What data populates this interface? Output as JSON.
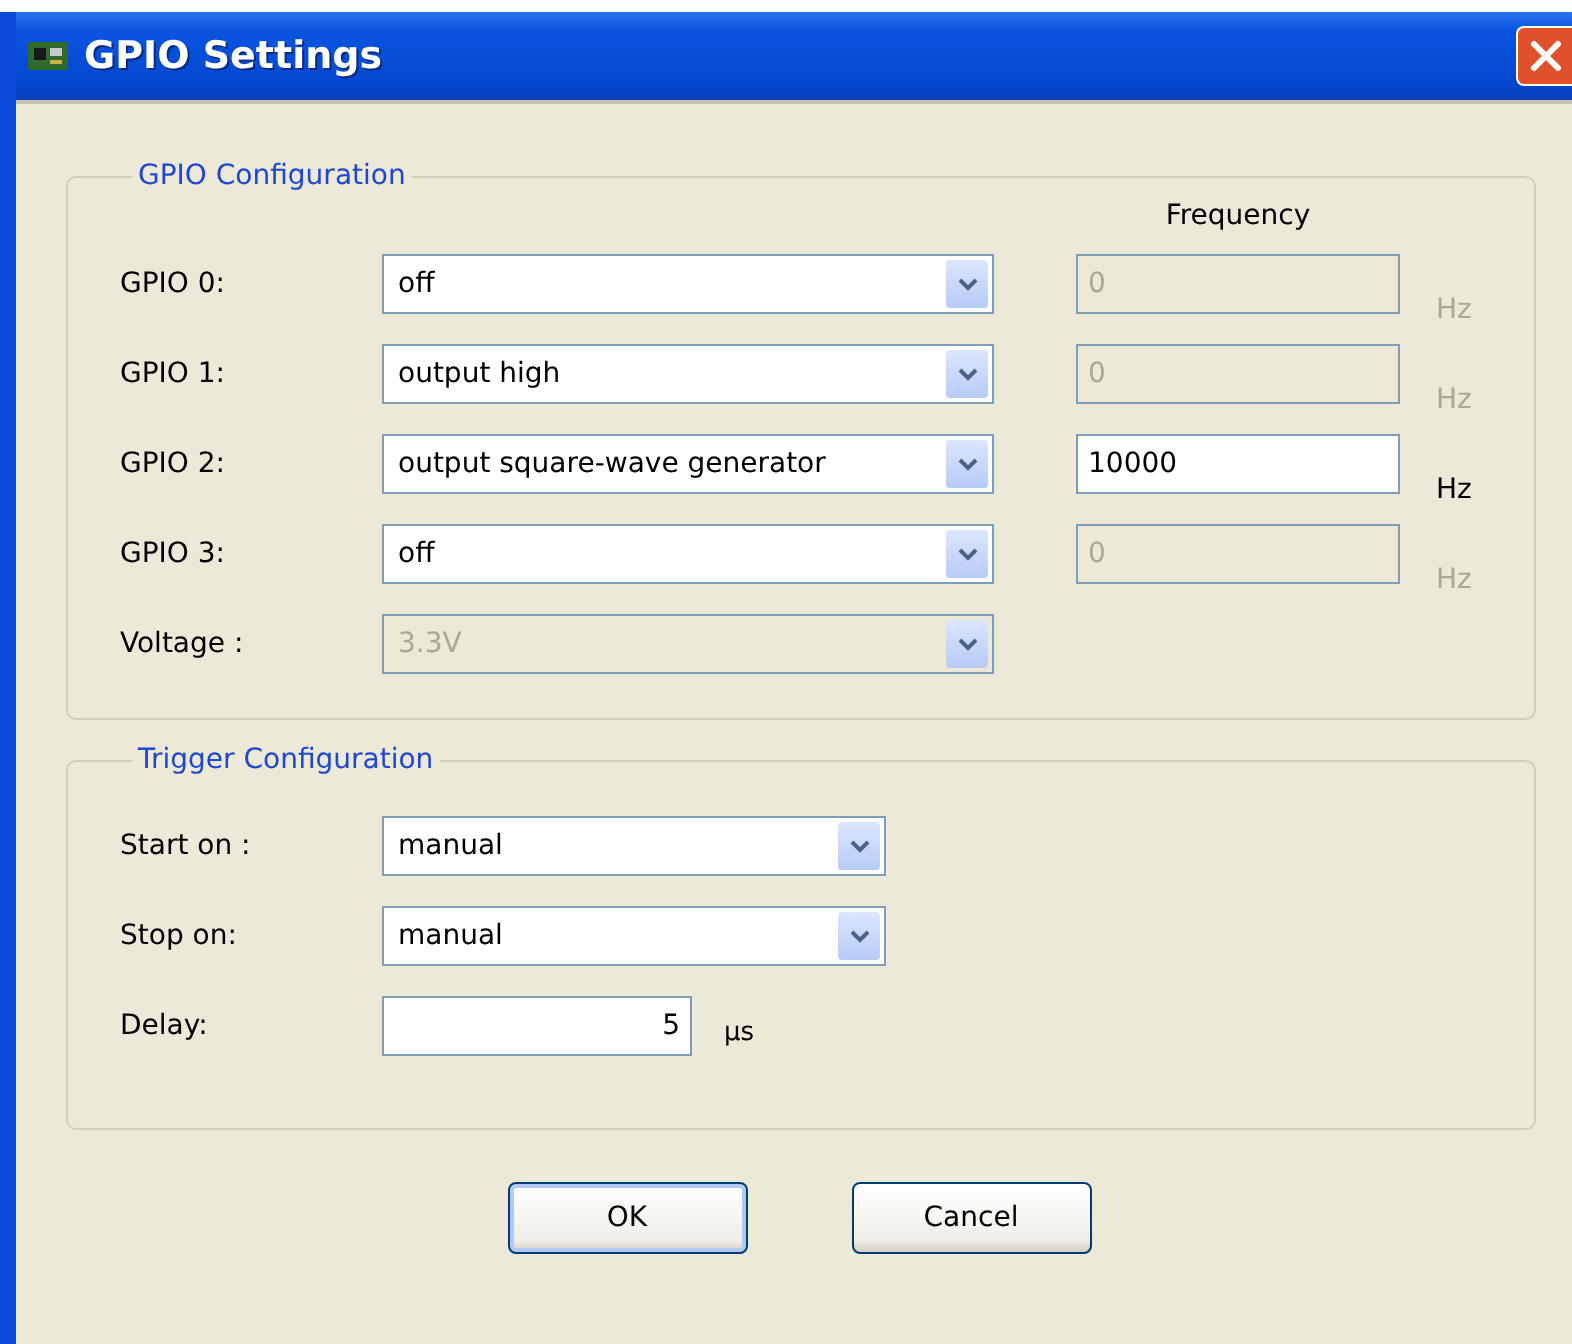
{
  "window": {
    "title": "GPIO Settings"
  },
  "gpio_configuration": {
    "title": "GPIO Configuration",
    "frequency_heading": "Frequency",
    "rows": [
      {
        "label": "GPIO 0:",
        "value": "off",
        "frequency": "0",
        "frequency_disabled": true,
        "unit": "Hz"
      },
      {
        "label": "GPIO 1:",
        "value": "output high",
        "frequency": "0",
        "frequency_disabled": true,
        "unit": "Hz"
      },
      {
        "label": "GPIO 2:",
        "value": "output square-wave generator",
        "frequency": "10000",
        "frequency_disabled": false,
        "unit": "Hz"
      },
      {
        "label": "GPIO 3:",
        "value": "off",
        "frequency": "0",
        "frequency_disabled": true,
        "unit": "Hz"
      }
    ],
    "voltage": {
      "label": "Voltage :",
      "value": "3.3V",
      "disabled": true
    }
  },
  "trigger_configuration": {
    "title": "Trigger Configuration",
    "start": {
      "label": "Start on :",
      "value": "manual"
    },
    "stop": {
      "label": "Stop on:",
      "value": "manual"
    },
    "delay": {
      "label": "Delay:",
      "value": "5",
      "unit": "µs"
    }
  },
  "buttons": [
    {
      "label": "OK",
      "default": true
    },
    {
      "label": "Cancel",
      "default": false
    }
  ]
}
